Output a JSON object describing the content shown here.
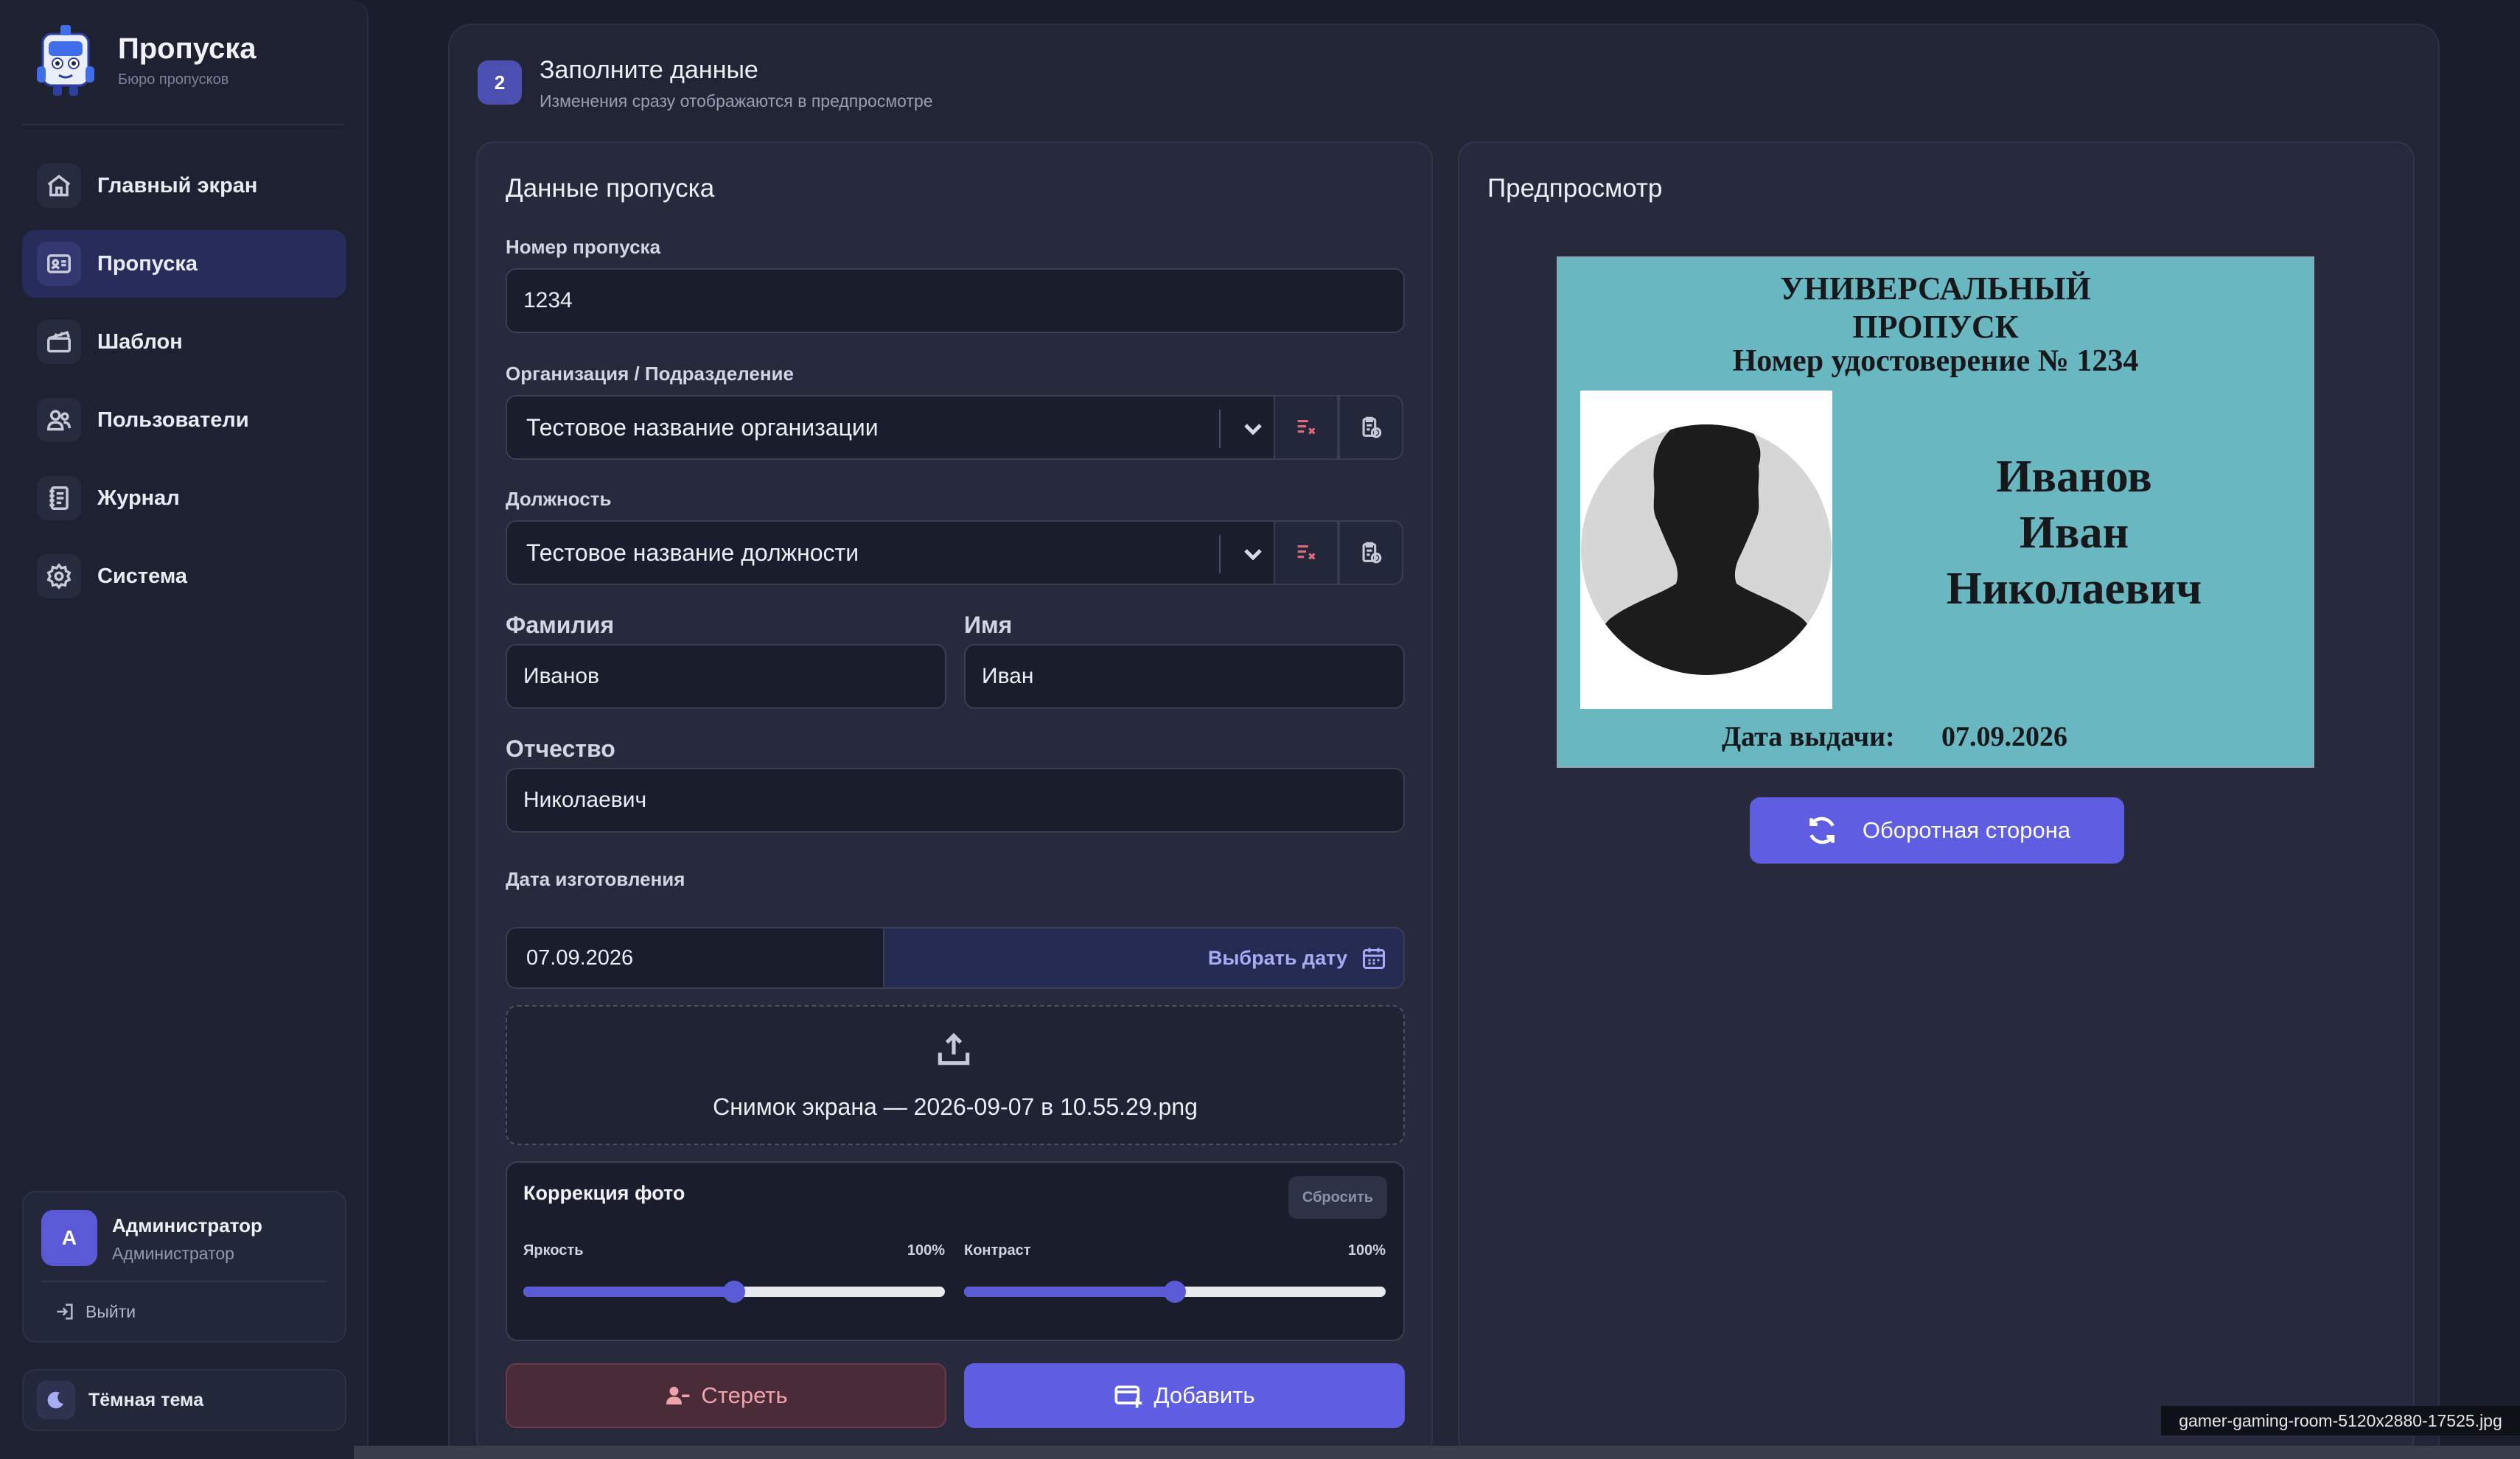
{
  "sidebar": {
    "app_title": "Пропуска",
    "app_subtitle": "Бюро пропусков",
    "items": [
      {
        "label": "Главный экран",
        "icon": "home-icon"
      },
      {
        "label": "Пропуска",
        "icon": "id-card-icon",
        "active": true
      },
      {
        "label": "Шаблон",
        "icon": "clapperboard-icon"
      },
      {
        "label": "Пользователи",
        "icon": "users-icon"
      },
      {
        "label": "Журнал",
        "icon": "journal-icon"
      },
      {
        "label": "Система",
        "icon": "gear-icon"
      }
    ],
    "user": {
      "initial": "А",
      "name": "Администратор",
      "role": "Администратор",
      "logout": "Выйти"
    },
    "theme_label": "Тёмная тема"
  },
  "step": {
    "number": "2",
    "title": "Заполните данные",
    "subtitle": "Изменения сразу отображаются в предпросмотре"
  },
  "form": {
    "title": "Данные пропуска",
    "pass_number_label": "Номер пропуска",
    "pass_number": "1234",
    "org_label": "Организация / Подразделение",
    "org_value": "Тестовое название организации",
    "position_label": "Должность",
    "position_value": "Тестовое название должности",
    "surname_label": "Фамилия",
    "surname": "Иванов",
    "name_label": "Имя",
    "name": "Иван",
    "patronymic_label": "Отчество",
    "patronymic": "Николаевич",
    "date_label": "Дата изготовления",
    "date_value": "07.09.2026",
    "date_button": "Выбрать дату",
    "upload_filename": "Снимок экрана — 2026-09-07 в 10.55.29.png",
    "correction": {
      "title": "Коррекция фото",
      "reset": "Сбросить",
      "brightness_label": "Яркость",
      "brightness_value": "100%",
      "brightness_level": 0.5,
      "contrast_label": "Контраст",
      "contrast_value": "100%",
      "contrast_level": 0.5
    },
    "clear_button": "Стереть",
    "add_button": "Добавить"
  },
  "preview": {
    "title": "Предпросмотр",
    "pass_title_line1": "УНИВЕРСАЛЬНЫЙ",
    "pass_title_line2": "ПРОПУСК",
    "pass_number_text": "Номер удостоверение №  1234",
    "surname": "Иванов",
    "name": "Иван",
    "patronymic": "Николаевич",
    "date_label": "Дата выдачи:",
    "date": "07.09.2026",
    "flip_button": "Оборотная сторона",
    "pass_background": "#69b8c1"
  },
  "footer": {
    "filename": "gamer-gaming-room-5120x2880-17525.jpg"
  },
  "colors": {
    "accent": "#5f5ee3",
    "danger": "#f0a3ac",
    "background": "#1a1d2b"
  }
}
